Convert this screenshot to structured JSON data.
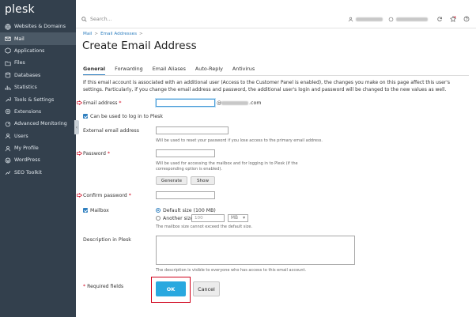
{
  "brand": {
    "logo": "plesk"
  },
  "sidebar": {
    "items": [
      {
        "label": "Websites & Domains",
        "icon": "globe-icon"
      },
      {
        "label": "Mail",
        "icon": "mail-icon",
        "active": true
      },
      {
        "label": "Applications",
        "icon": "apps-icon"
      },
      {
        "label": "Files",
        "icon": "folder-icon"
      },
      {
        "label": "Databases",
        "icon": "database-icon"
      },
      {
        "label": "Statistics",
        "icon": "stats-icon"
      },
      {
        "label": "Tools & Settings",
        "icon": "tools-icon"
      },
      {
        "label": "Extensions",
        "icon": "extensions-icon"
      },
      {
        "label": "Advanced Monitoring",
        "icon": "monitoring-icon"
      },
      {
        "label": "Users",
        "icon": "users-icon"
      },
      {
        "label": "My Profile",
        "icon": "profile-icon"
      },
      {
        "label": "WordPress",
        "icon": "wordpress-icon"
      },
      {
        "label": "SEO Toolkit",
        "icon": "seo-icon"
      }
    ],
    "collapse_glyph": "‹"
  },
  "topbar": {
    "search_placeholder": "Search..."
  },
  "breadcrumb": {
    "items": [
      "Mail",
      "Email Addresses"
    ],
    "separator": ">"
  },
  "page": {
    "title": "Create Email Address",
    "tabs": [
      "General",
      "Forwarding",
      "Email Aliases",
      "Auto-Reply",
      "Antivirus"
    ],
    "active_tab": "General",
    "intro": "If this email account is associated with an additional user (Access to the Customer Panel is enabled), the changes you make on this page affect this user's settings. Particularly, if you change the email address and password, the additional user's login and password will be changed to the new values as well."
  },
  "form": {
    "email_label": "Email address",
    "email_at": "@",
    "email_tld": ".com",
    "login_checkbox_label": "Can be used to log in to Plesk",
    "external_email_label": "External email address",
    "external_email_hint": "Will be used to reset your password if you lose access to the primary email address.",
    "password_label": "Password",
    "password_hint": "Will be used for accessing the mailbox and for logging in to Plesk (if the corresponding option is enabled).",
    "generate_label": "Generate",
    "show_label": "Show",
    "confirm_label": "Confirm password",
    "mailbox_label": "Mailbox",
    "default_size_label": "Default size (100 MB)",
    "another_size_label": "Another size",
    "another_size_value": "100",
    "size_unit": "MB",
    "mailbox_hint": "The mailbox size cannot exceed the default size.",
    "description_label": "Description in Plesk",
    "description_hint": "The description is visible to everyone who has access to this email account.",
    "required_note": "Required fields",
    "required_star": "*",
    "ok_label": "OK",
    "cancel_label": "Cancel"
  },
  "colors": {
    "sidebar_bg": "#33404d",
    "accent": "#2f7fbf",
    "ok_button": "#29a8df",
    "annotation_red": "#d0021b"
  }
}
